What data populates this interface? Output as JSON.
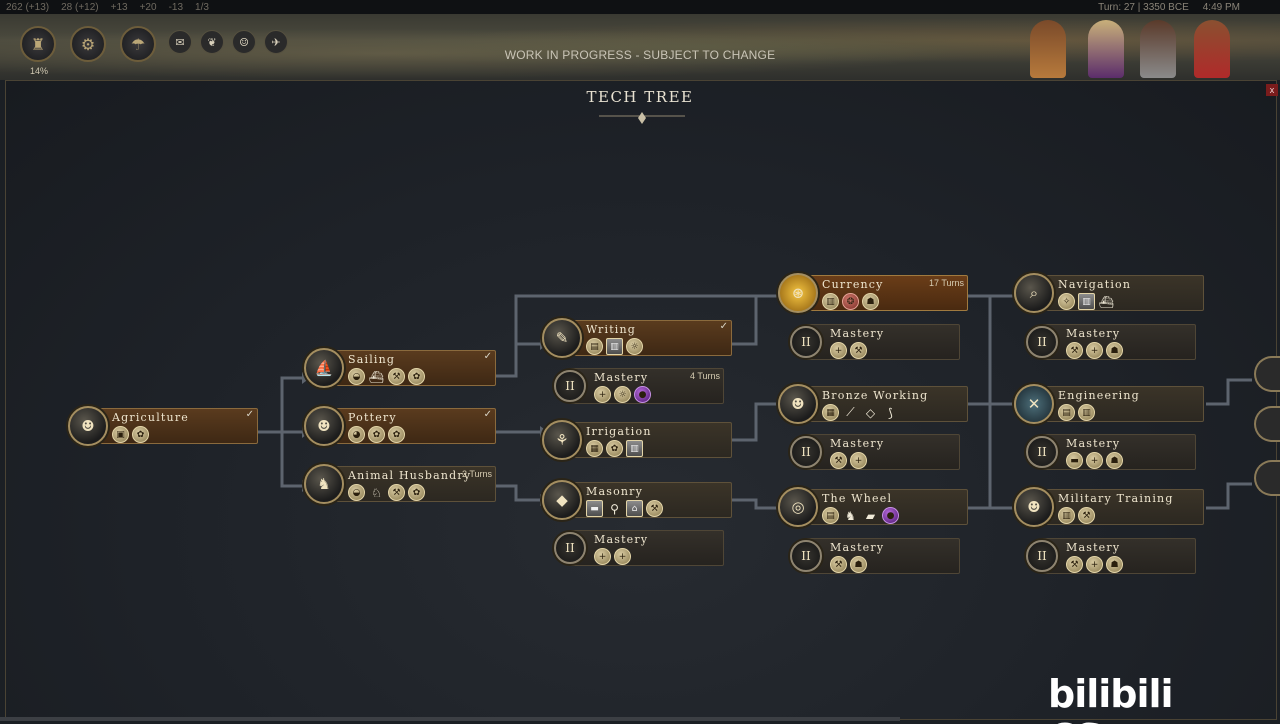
{
  "hud": {
    "resources": [
      "262 (+13)",
      "28 (+12)",
      "+13",
      "+20",
      "-13",
      "1/3"
    ],
    "turn": "Turn: 27",
    "year": "3350 BCE",
    "clock": "4:49 PM",
    "progress_pct": "14%",
    "banner": "WORK IN PROGRESS - SUBJECT TO CHANGE"
  },
  "panel": {
    "title": "TECH TREE",
    "close_label": "x"
  },
  "techs": {
    "agriculture": {
      "name": "Agriculture",
      "status": "✓"
    },
    "sailing": {
      "name": "Sailing",
      "status": "✓"
    },
    "pottery": {
      "name": "Pottery",
      "status": "✓"
    },
    "animal_husbandry": {
      "name": "Animal Husbandry",
      "turns": "2 Turns"
    },
    "writing": {
      "name": "Writing",
      "status": "✓"
    },
    "writing_mastery": {
      "name": "Mastery",
      "turns": "4 Turns"
    },
    "irrigation": {
      "name": "Irrigation"
    },
    "masonry": {
      "name": "Masonry"
    },
    "masonry_mastery": {
      "name": "Mastery"
    },
    "currency": {
      "name": "Currency",
      "turns": "17 Turns"
    },
    "currency_mastery": {
      "name": "Mastery"
    },
    "bronze_working": {
      "name": "Bronze Working"
    },
    "bronze_mastery": {
      "name": "Mastery"
    },
    "the_wheel": {
      "name": "The Wheel"
    },
    "wheel_mastery": {
      "name": "Mastery"
    },
    "navigation": {
      "name": "Navigation"
    },
    "navigation_mastery": {
      "name": "Mastery"
    },
    "engineering": {
      "name": "Engineering"
    },
    "engineering_mastery": {
      "name": "Mastery"
    },
    "military_training": {
      "name": "Military Training"
    },
    "military_mastery": {
      "name": "Mastery"
    }
  },
  "mastery_glyph": "II",
  "watermark": "bilibili CScgy"
}
